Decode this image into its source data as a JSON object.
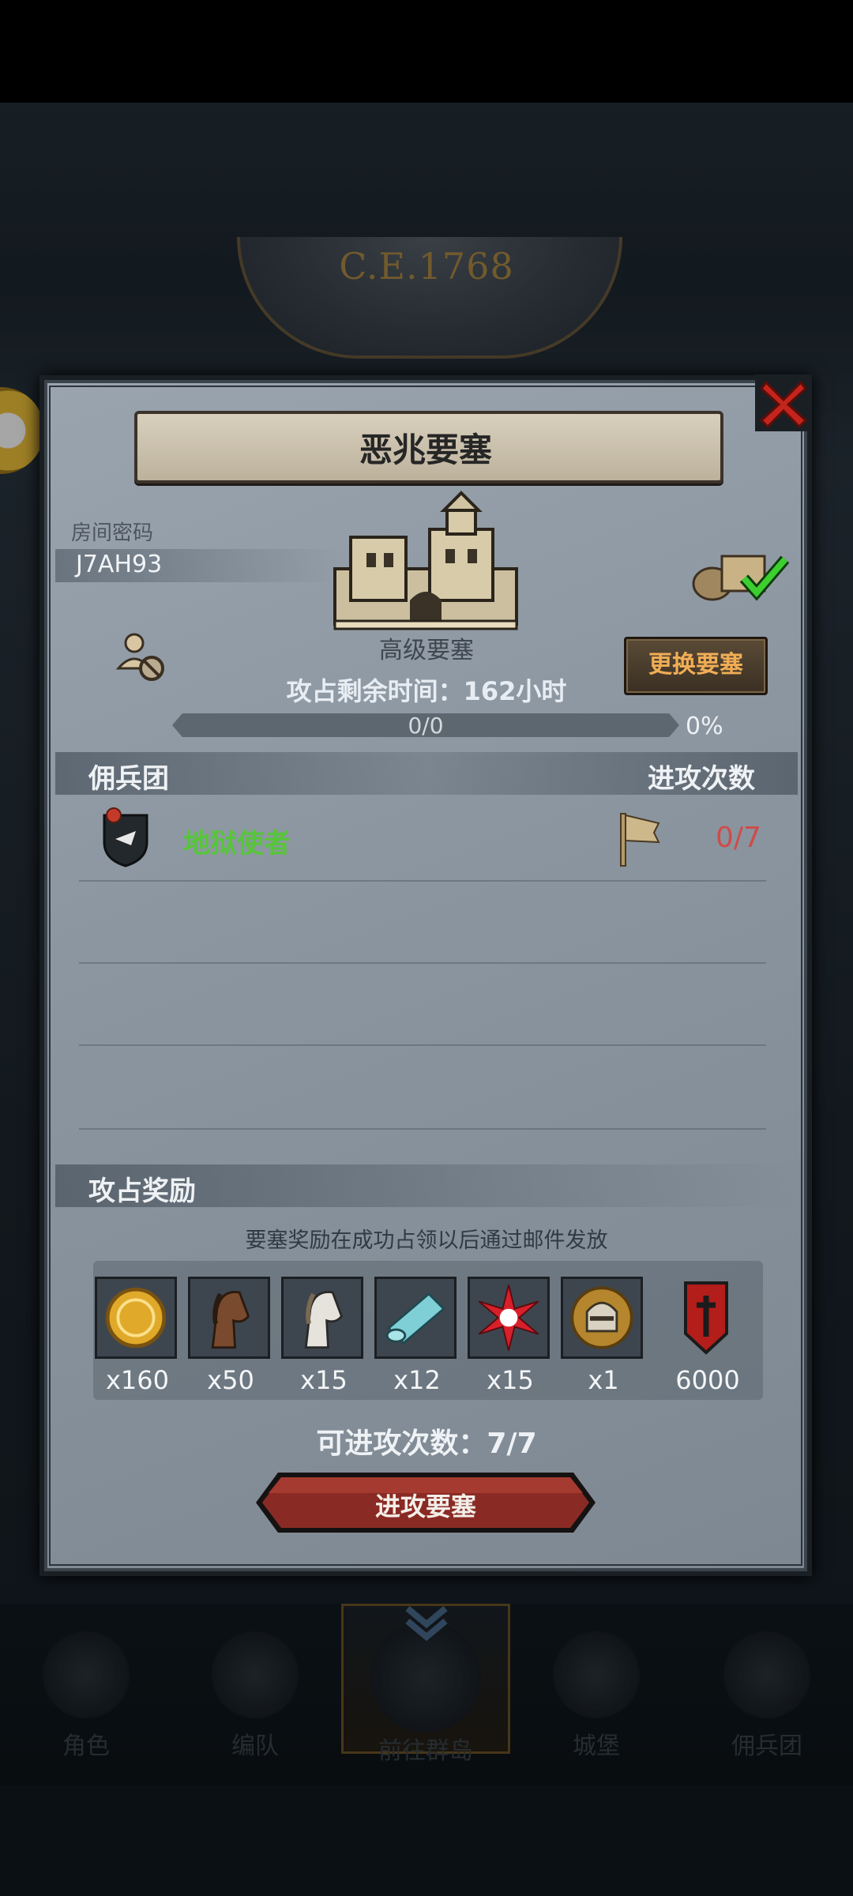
{
  "background": {
    "era": "C.E.1768"
  },
  "dialog": {
    "title": "恶兆要塞",
    "room_label": "房间密码",
    "room_code": "J7AH93",
    "fortress_type": "高级要塞",
    "change_button": "更换要塞",
    "time_label": "攻占剩余时间：",
    "time_value": "162",
    "time_unit": "小时",
    "progress_text": "0/0",
    "progress_percent": "0%",
    "progress_fraction": 0,
    "merc_label": "佣兵团",
    "attack_count_label": "进攻次数",
    "guilds": [
      {
        "name": "地狱使者",
        "attempts": "0/7"
      }
    ],
    "reward_label": "攻占奖励",
    "reward_note": "要塞奖励在成功占领以后通过邮件发放",
    "rewards": [
      {
        "icon": "gold-coin-icon",
        "qty": "x160"
      },
      {
        "icon": "brown-horse-icon",
        "qty": "x50"
      },
      {
        "icon": "white-horse-icon",
        "qty": "x15"
      },
      {
        "icon": "cloth-roll-icon",
        "qty": "x12"
      },
      {
        "icon": "red-star-icon",
        "qty": "x15"
      },
      {
        "icon": "knight-helmet-icon",
        "qty": "x1"
      },
      {
        "icon": "red-banner-icon",
        "qty": "6000"
      }
    ],
    "attempts_label": "可进攻次数：",
    "attempts_value": "7/7",
    "attack_button": "进攻要塞"
  },
  "bottom_nav": [
    {
      "label": "角色"
    },
    {
      "label": "编队"
    },
    {
      "label": "前往群岛",
      "selected": true
    },
    {
      "label": "城堡"
    },
    {
      "label": "佣兵团"
    }
  ],
  "colors": {
    "guild_name": "#57c53a",
    "attempts_red": "#cf4b4b",
    "change_button_text": "#f0ad55"
  }
}
